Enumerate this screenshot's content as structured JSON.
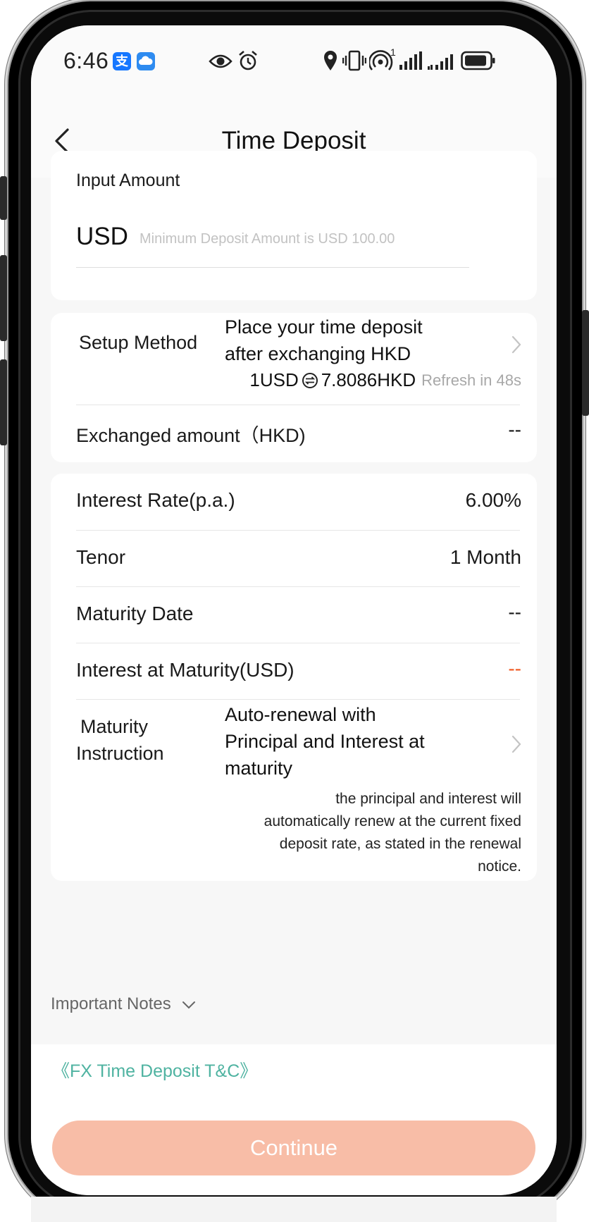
{
  "status_bar": {
    "time": "6:46",
    "app_badge_1_glyph": "支",
    "notification_count": "1",
    "icons": [
      "alipay-icon",
      "cloud-icon",
      "eye-icon",
      "alarm-icon",
      "location-icon",
      "vibrate-icon",
      "hotspot-icon",
      "signal-icon",
      "signal-icon-2",
      "battery-icon"
    ]
  },
  "header": {
    "title": "Time Deposit",
    "back_icon": "chevron-left-icon"
  },
  "amount_card": {
    "label": "Input Amount",
    "currency": "USD",
    "placeholder": "Minimum Deposit Amount is USD 100.00",
    "value": ""
  },
  "setup_card": {
    "setup_method_label": "Setup Method",
    "setup_method_value_line1": "Place your time deposit",
    "setup_method_value_line2": "after exchanging HKD",
    "rate_from": "1USD",
    "rate_to": "7.8086HKD",
    "refresh_text": "Refresh in 48s",
    "exchanged_label": "Exchanged amount（HKD)",
    "exchanged_value": "--"
  },
  "details_card": {
    "interest_rate_label": "Interest Rate(p.a.)",
    "interest_rate_value": "6.00%",
    "tenor_label": "Tenor",
    "tenor_value": "1 Month",
    "maturity_date_label": "Maturity Date",
    "maturity_date_value": "--",
    "interest_at_maturity_label": "Interest at Maturity(USD)",
    "interest_at_maturity_value": "--",
    "maturity_instruction_label_line1": "Maturity",
    "maturity_instruction_label_line2": "Instruction",
    "maturity_instruction_value_line1": "Auto-renewal with",
    "maturity_instruction_value_line2": "Principal and Interest at",
    "maturity_instruction_value_line3": "maturity",
    "maturity_instruction_desc_line1": "the principal and interest will",
    "maturity_instruction_desc_line2": "automatically renew at the current fixed",
    "maturity_instruction_desc_line3": "deposit rate, as stated in the renewal",
    "maturity_instruction_desc_line4": "notice."
  },
  "notes": {
    "label": "Important Notes"
  },
  "footer": {
    "tnc_link": "《FX Time Deposit T&C》",
    "continue_label": "Continue"
  },
  "colors": {
    "accent_link": "#4fb3a1",
    "continue_disabled": "#f8bda7",
    "orange_value": "#f05a23",
    "background": "#f7f7f7"
  }
}
